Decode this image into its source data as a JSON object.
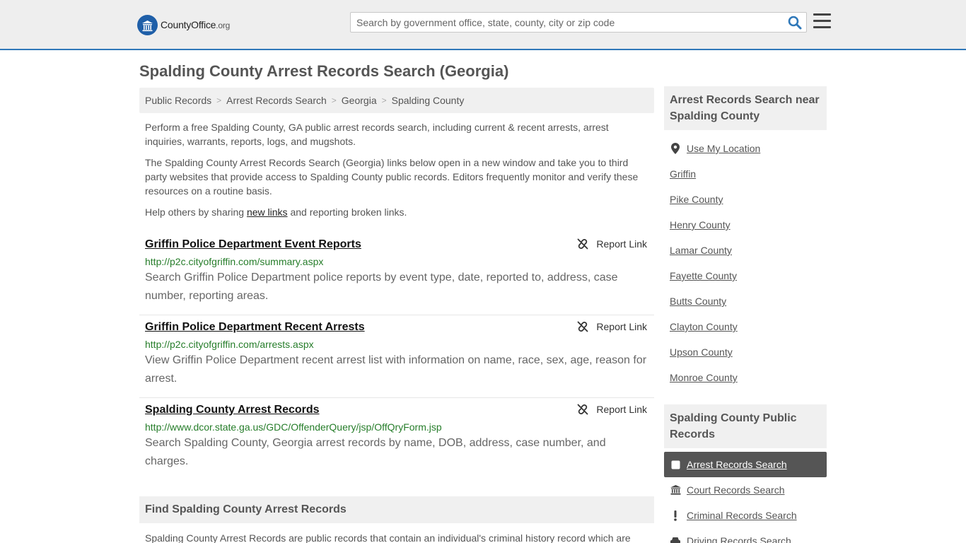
{
  "header": {
    "logo_brand": "CountyOffice",
    "logo_tld": ".org",
    "search_placeholder": "Search by government office, state, county, city or zip code"
  },
  "page_title": "Spalding County Arrest Records Search (Georgia)",
  "breadcrumb": [
    "Public Records",
    "Arrest Records Search",
    "Georgia",
    "Spalding County"
  ],
  "intro": {
    "p1": "Perform a free Spalding County, GA public arrest records search, including current & recent arrests, arrest inquiries, warrants, reports, logs, and mugshots.",
    "p2": "The Spalding County Arrest Records Search (Georgia) links below open in a new window and take you to third party websites that provide access to Spalding County public records. Editors frequently monitor and verify these resources on a routine basis.",
    "p3_before": "Help others by sharing ",
    "p3_link": "new links",
    "p3_after": " and reporting broken links."
  },
  "report_label": "Report Link",
  "results": [
    {
      "title": "Griffin Police Department Event Reports",
      "url": "http://p2c.cityofgriffin.com/summary.aspx",
      "desc": "Search Griffin Police Department police reports by event type, date, reported to, address, case number, reporting areas."
    },
    {
      "title": "Griffin Police Department Recent Arrests",
      "url": "http://p2c.cityofgriffin.com/arrests.aspx",
      "desc": "View Griffin Police Department recent arrest list with information on name, race, sex, age, reason for arrest."
    },
    {
      "title": "Spalding County Arrest Records",
      "url": "http://www.dcor.state.ga.us/GDC/OffenderQuery/jsp/OffQryForm.jsp",
      "desc": "Search Spalding County, Georgia arrest records by name, DOB, address, case number, and charges."
    }
  ],
  "find_heading": "Find Spalding County Arrest Records",
  "bottom_text": "Spalding County Arrest Records are public records that contain an individual's criminal history record which are",
  "sidebar": {
    "near_heading": "Arrest Records Search near Spalding County",
    "near_items": [
      "Use My Location",
      "Griffin",
      "Pike County",
      "Henry County",
      "Lamar County",
      "Fayette County",
      "Butts County",
      "Clayton County",
      "Upson County",
      "Monroe County"
    ],
    "public_heading": "Spalding County Public Records",
    "public_items": [
      "Arrest Records Search",
      "Court Records Search",
      "Criminal Records Search",
      "Driving Records Search"
    ]
  },
  "colors": {
    "accent": "#2f78b9",
    "url_green": "#267d2a",
    "active_bg": "#555555"
  }
}
